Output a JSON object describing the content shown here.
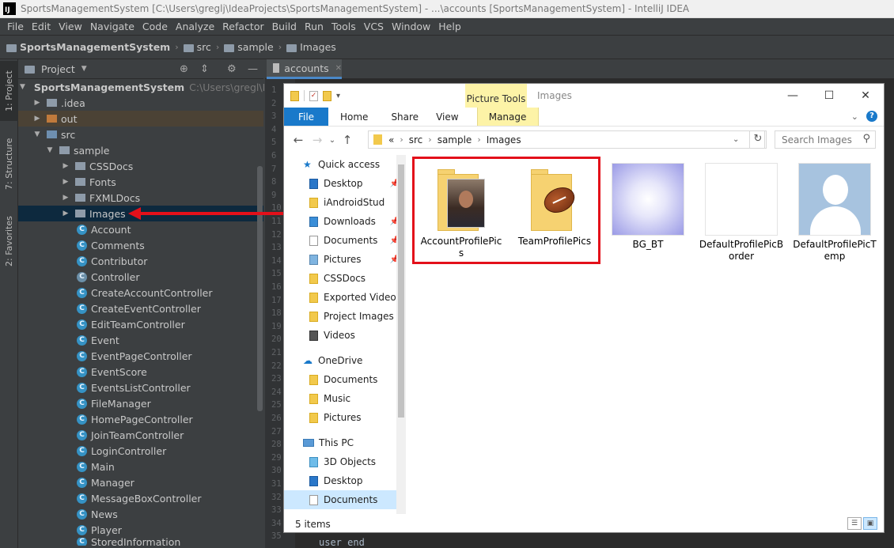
{
  "window_title": "SportsManagementSystem [C:\\Users\\greglj\\IdeaProjects\\SportsManagementSystem] - ...\\accounts [SportsManagementSystem] - IntelliJ IDEA",
  "menu": [
    "File",
    "Edit",
    "View",
    "Navigate",
    "Code",
    "Analyze",
    "Refactor",
    "Build",
    "Run",
    "Tools",
    "VCS",
    "Window",
    "Help"
  ],
  "breadcrumb": [
    "SportsManagementSystem",
    "src",
    "sample",
    "Images"
  ],
  "left_tabs": {
    "project": "1: Project",
    "structure": "7: Structure",
    "favorites": "2: Favorites"
  },
  "project_panel": {
    "title": "Project",
    "root_name": "SportsManagementSystem",
    "root_path": "C:\\Users\\gregl\\IdeaPro",
    "folders": {
      "idea": ".idea",
      "out": "out",
      "src": "src",
      "sample": "sample",
      "cssdocs": "CSSDocs",
      "fonts": "Fonts",
      "fxmldocs": "FXMLDocs",
      "images": "Images"
    },
    "classes": [
      "Account",
      "Comments",
      "Contributor",
      "Controller",
      "CreateAccountController",
      "CreateEventController",
      "EditTeamController",
      "Event",
      "EventPageController",
      "EventScore",
      "EventsListController",
      "FileManager",
      "HomePageController",
      "JoinTeamController",
      "LoginController",
      "Main",
      "Manager",
      "MessageBoxController",
      "News",
      "Player",
      "StoredInformation"
    ]
  },
  "editor": {
    "tab": "accounts",
    "line_numbers": [
      "1",
      "2",
      "3",
      "4",
      "5",
      "6",
      "7",
      "8",
      "9",
      "10",
      "11",
      "12",
      "13",
      "14",
      "15",
      "16",
      "17",
      "18",
      "19",
      "20",
      "21",
      "22",
      "23",
      "24",
      "25",
      "26",
      "27",
      "28",
      "29",
      "30",
      "31",
      "32",
      "33",
      "34",
      "35"
    ],
    "code_last_line": "user end"
  },
  "explorer": {
    "picture_tools": "Picture Tools",
    "title": "Images",
    "ribbon": {
      "file": "File",
      "home": "Home",
      "share": "Share",
      "view": "View",
      "manage": "Manage"
    },
    "address": {
      "prefix": "«",
      "parts": [
        "src",
        "sample",
        "Images"
      ]
    },
    "search_placeholder": "Search Images",
    "nav": {
      "quick_access": "Quick access",
      "quick_items": [
        "Desktop",
        "iAndroidStud",
        "Downloads",
        "Documents",
        "Pictures",
        "CSSDocs",
        "Exported Videos",
        "Project Images",
        "Videos"
      ],
      "onedrive": "OneDrive",
      "onedrive_items": [
        "Documents",
        "Music",
        "Pictures"
      ],
      "this_pc": "This PC",
      "pc_items": [
        "3D Objects",
        "Desktop",
        "Documents"
      ]
    },
    "items": {
      "account_pics": "AccountProfilePics",
      "team_pics": "TeamProfilePics",
      "bg_bt": "BG_BT",
      "default_border": "DefaultProfilePicBorder",
      "default_temp": "DefaultProfilePicTemp"
    },
    "status": "5 items"
  }
}
